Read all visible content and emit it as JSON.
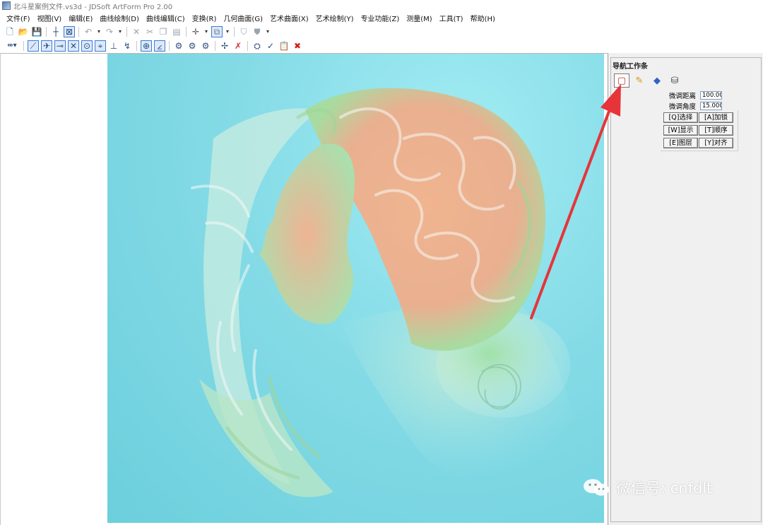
{
  "window": {
    "title": "北斗星案例文件.vs3d - JDSoft ArtForm Pro 2.00"
  },
  "menu": [
    "文件(F)",
    "视图(V)",
    "编辑(E)",
    "曲线绘制(D)",
    "曲线编辑(C)",
    "变换(R)",
    "几何曲面(G)",
    "艺术曲面(X)",
    "艺术绘制(Y)",
    "专业功能(Z)",
    "测量(M)",
    "工具(T)",
    "帮助(H)"
  ],
  "toolbar1": {
    "icons": [
      "new-file-icon",
      "open-file-icon",
      "save-icon",
      "crosshair-icon",
      "select-box-icon",
      "undo-icon",
      "redo-icon",
      "cut-icon",
      "scissors-icon",
      "copy-icon",
      "paste-icon",
      "axis-icon",
      "view-cube-icon",
      "render-icon",
      "shade-icon"
    ]
  },
  "toolbar2": {
    "icons": [
      "snap-icon",
      "line-icon",
      "trim-icon",
      "extend-icon",
      "intersect-icon",
      "circle-icon",
      "target-icon",
      "perpendicular-icon",
      "tangent-icon",
      "grid-snap-icon",
      "coord-icon",
      "surface-a-icon",
      "surface-b-icon",
      "surface-c-icon",
      "node-icon",
      "node-delete-icon",
      "layer-icon",
      "check-icon",
      "clipboard-icon",
      "delete-icon"
    ],
    "delete_color": "#d3201b",
    "active_color": "#3d7bd6"
  },
  "nav_panel": {
    "title": "导航工作条",
    "tabs": [
      "frame-icon",
      "edit-pencil-icon",
      "eraser-icon",
      "layer-stack-icon"
    ],
    "fine_distance_label": "微调距离",
    "fine_distance_value": "100.00",
    "fine_angle_label": "微调角度",
    "fine_angle_value": "15.000",
    "buttons": [
      [
        "[Q]选择",
        "[A]加锁"
      ],
      [
        "[W]显示",
        "[T]顺序"
      ],
      [
        "[E]图层",
        "[Y]对齐"
      ]
    ]
  },
  "annotation": {
    "arrow_color": "#e5353a"
  },
  "watermark": {
    "text": "微信号: cnfdlt"
  }
}
